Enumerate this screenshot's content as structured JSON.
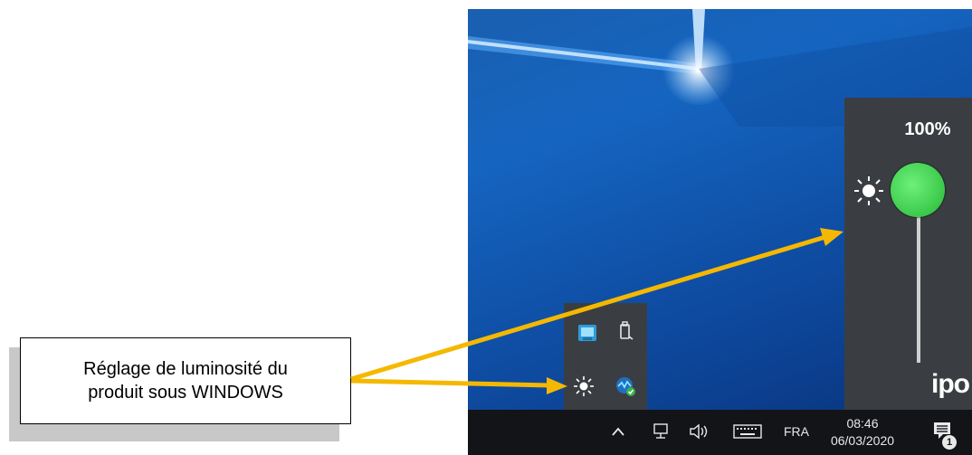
{
  "callout": {
    "line1": "Réglage de luminosité du",
    "line2": "produit sous WINDOWS"
  },
  "brightness_panel": {
    "level_text": "100%",
    "level_value": 1.0,
    "logo_text": "ipo",
    "knob_color": "#4cd95a"
  },
  "tray_popup": {
    "icons": [
      "network-monitor-icon",
      "usb-device-icon",
      "brightness-icon",
      "security-check-icon"
    ]
  },
  "taskbar": {
    "language": "FRA",
    "time": "08:46",
    "date": "06/03/2020",
    "notification_count": "1"
  },
  "colors": {
    "arrow": "#f5b800",
    "taskbar": "#121417",
    "panel": "#3a3e42"
  }
}
